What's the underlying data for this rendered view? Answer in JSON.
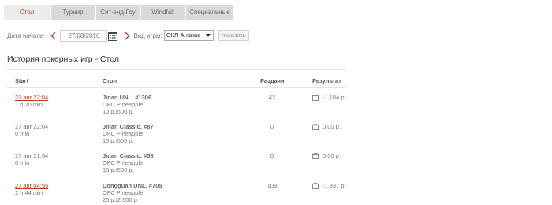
{
  "tabs": [
    {
      "label": "Стол",
      "active": true
    },
    {
      "label": "Турнир",
      "active": false
    },
    {
      "label": "Сит-энд-Гоу",
      "active": false
    },
    {
      "label": "Windfall",
      "active": false
    },
    {
      "label": "Специальные",
      "active": false
    }
  ],
  "filters": {
    "date_label": "Дата начала",
    "date_value": "27/08/2016",
    "game_label": "Вид игры:",
    "game_value": "ОКП Ананас",
    "show_label": "показать"
  },
  "page_title": "История покерных игр - Стол",
  "table": {
    "headers": {
      "start": "Start",
      "table": "Стол",
      "hands": "Раздачи",
      "result": "Результат"
    },
    "rows": [
      {
        "date": "27 авг 22:04",
        "duration": "1 h 20 min",
        "table_name": "Jinan UNL. #1306",
        "game": "OFC Pineapple",
        "stakes": "10 р./500 р.",
        "hands": "42",
        "result": "-1 184 р."
      },
      {
        "date": "27 авг 22:04",
        "duration": "0 min",
        "table_name": "Jinan Classic. #87",
        "game": "OFC Pineapple",
        "stakes": "10 р./500 р.",
        "hands": "0",
        "result": "0,00 р."
      },
      {
        "date": "27 авг 21:54",
        "duration": "0 min",
        "table_name": "Jinan Classic. #58",
        "game": "OFC Pineapple",
        "stakes": "10 р./500 р.",
        "hands": "0",
        "result": "0,00 р."
      },
      {
        "date": "27 авг 04:55",
        "duration": "2 h 44 min",
        "table_name": "Dongguan UNL. #705",
        "game": "OFC Pineapple",
        "stakes": "25 р./2 500 р.",
        "hands": "109",
        "result": "-1 837 р."
      }
    ]
  },
  "colors": {
    "accent": "#c0392b",
    "tab_bg": "#d9d9d9",
    "tab_active_bg": "#ececec"
  }
}
